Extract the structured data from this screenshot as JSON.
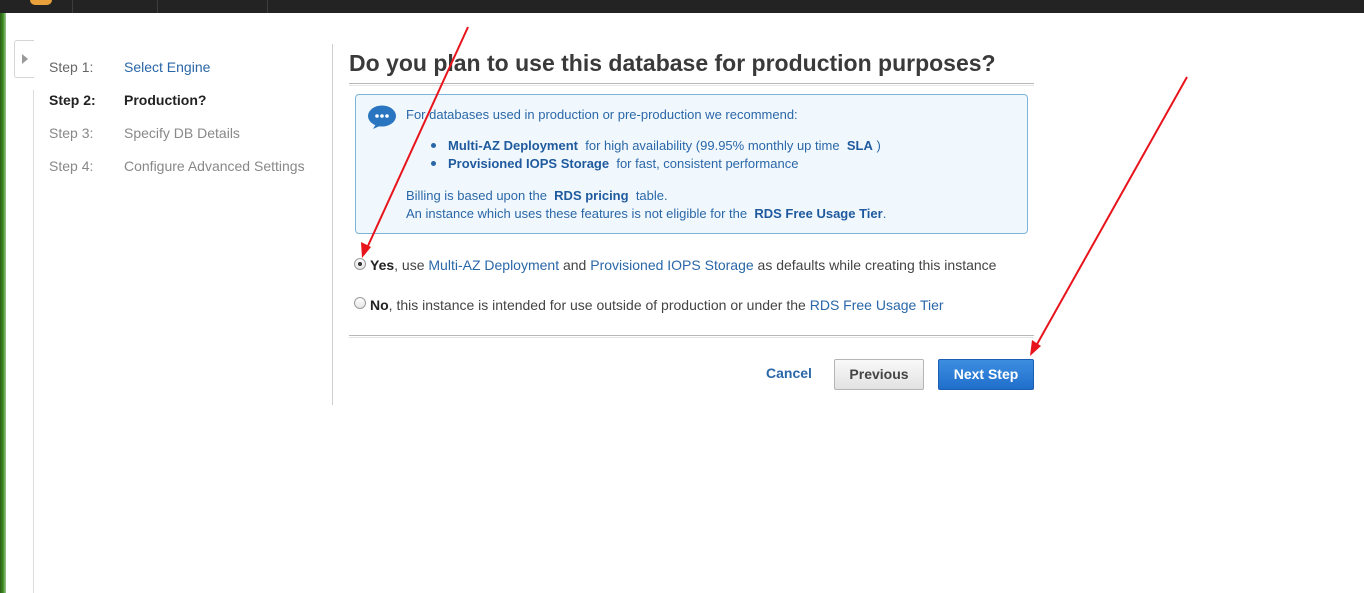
{
  "wizard": {
    "steps": [
      {
        "number": "Step 1:",
        "label": "Select Engine"
      },
      {
        "number": "Step 2:",
        "label": "Production?"
      },
      {
        "number": "Step 3:",
        "label": "Specify DB Details"
      },
      {
        "number": "Step 4:",
        "label": "Configure Advanced Settings"
      }
    ],
    "active_step": 2
  },
  "page": {
    "title": "Do you plan to use this database for production purposes?"
  },
  "info": {
    "intro": "For databases used in production or pre-production we recommend:",
    "bullet1": {
      "strong": "Multi-AZ Deployment",
      "text": "for high availability (99.95% monthly up time",
      "strong2": "SLA",
      "tail": ")"
    },
    "bullet2": {
      "strong": "Provisioned IOPS Storage",
      "text": "for fast, consistent performance"
    },
    "billing": {
      "pre": "Billing is based upon the",
      "strong": "RDS pricing",
      "post": "table."
    },
    "eligibility": {
      "pre": "An instance which uses these features is not eligible for the",
      "strong": "RDS Free Usage Tier",
      "post": "."
    }
  },
  "options": {
    "yes": {
      "selected": true,
      "label": "Yes",
      "t1": ", use",
      "link1": "Multi-AZ Deployment",
      "t2": "and",
      "link2": "Provisioned IOPS Storage",
      "t3": "as defaults while creating this instance"
    },
    "no": {
      "selected": false,
      "label": "No",
      "t1": ", this instance is intended for use outside of production or under the",
      "link1": "RDS Free Usage Tier"
    }
  },
  "actions": {
    "cancel": "Cancel",
    "previous": "Previous",
    "next": "Next Step"
  },
  "colors": {
    "link": "#2a67a8",
    "primary_button": "#1f6fcd",
    "info_border": "#7db5d9",
    "annotation_arrow": "#e8141c"
  },
  "icons": {
    "info": "chat-bubble-icon",
    "collapse": "triangle-right-icon"
  }
}
